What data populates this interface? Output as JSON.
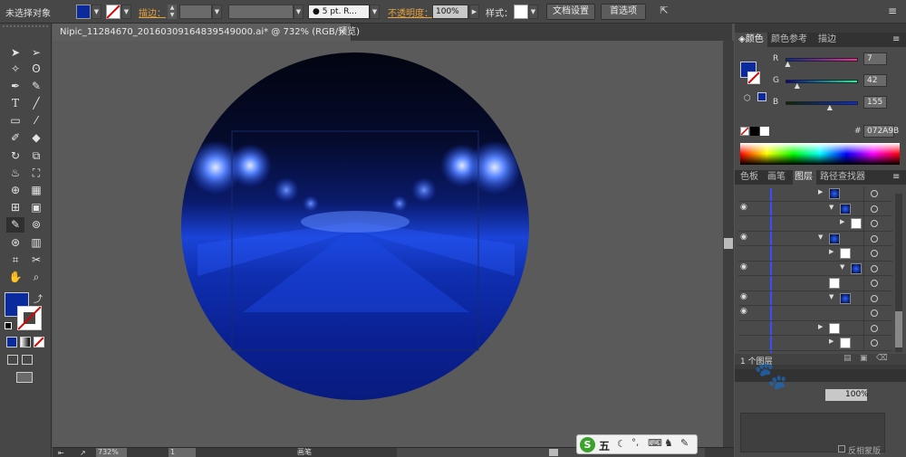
{
  "control_bar": {
    "selection_status": "未选择对象",
    "stroke_label": "描边：",
    "brush_value": "5 pt. R...",
    "opacity_label": "不透明度：",
    "opacity_value": "100%",
    "style_label": "样式：",
    "doc_setup_label": "文档设置",
    "preferences_label": "首选项"
  },
  "document": {
    "tab_title": "Nipic_11284670_20160309164839549000.ai* @ 732% (RGB/预览)",
    "close_glyph": "×",
    "zoom_value": "732%",
    "artboard_value": "1",
    "status_text": "画笔"
  },
  "color_panel": {
    "tabs": [
      "颜色",
      "颜色参考",
      "描边"
    ],
    "r_label": "R",
    "r_value": "7",
    "g_label": "G",
    "g_value": "42",
    "b_label": "B",
    "b_value": "155",
    "r_fraction": 0.03,
    "g_fraction": 0.16,
    "b_fraction": 0.61,
    "hex_label": "#",
    "hex_value": "072A9B",
    "fill_color": "#072A9B"
  },
  "layers_panel": {
    "tabs": [
      "色板",
      "画笔",
      "图层",
      "路径查找器"
    ],
    "footer_text": "1 个图层",
    "rows": [
      {
        "eye": false,
        "arrow": "▶",
        "thumb": "blue-small"
      },
      {
        "eye": true,
        "arrow": "▼",
        "thumb": "blue"
      },
      {
        "eye": false,
        "arrow": "▶",
        "thumb": "white"
      },
      {
        "eye": true,
        "arrow": "▼",
        "thumb": "blue"
      },
      {
        "eye": false,
        "arrow": "▶",
        "thumb": "white"
      },
      {
        "eye": true,
        "arrow": "▼",
        "thumb": "blue"
      },
      {
        "eye": false,
        "arrow": "",
        "thumb": "white"
      },
      {
        "eye": true,
        "arrow": "▼",
        "thumb": "blue"
      },
      {
        "eye": true,
        "arrow": "",
        "thumb": ""
      },
      {
        "eye": false,
        "arrow": "▶",
        "thumb": "white"
      },
      {
        "eye": false,
        "arrow": "▶",
        "thumb": "white"
      }
    ]
  },
  "transparency_panel": {
    "opacity_value": "100%",
    "invert_mask_label": "反相蒙版"
  },
  "ime_bar": {
    "logo": "S",
    "mode": "五"
  },
  "colors": {
    "ui_bg": "#535353",
    "panel_bg": "#4a4a4a",
    "accent_orange": "#e7a33e",
    "fill": "#0b2a9e"
  }
}
